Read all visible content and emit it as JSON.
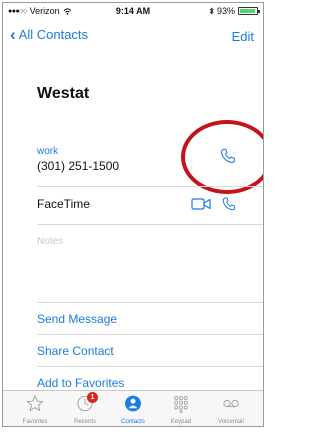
{
  "status_bar": {
    "carrier": "Verizon",
    "time": "9:14 AM",
    "battery_percent": "93%",
    "battery_level": 0.93
  },
  "nav": {
    "back_label": "All Contacts",
    "edit_label": "Edit"
  },
  "contact": {
    "name": "Westat",
    "phone_label": "work",
    "phone_number": "(301) 251-1500",
    "facetime_label": "FaceTime",
    "notes_placeholder": "Notes"
  },
  "actions": [
    "Send Message",
    "Share Contact",
    "Add to Favorites"
  ],
  "tabs": [
    {
      "label": "Favorites",
      "icon": "star-icon"
    },
    {
      "label": "Recents",
      "icon": "clock-icon",
      "badge": "1"
    },
    {
      "label": "Contacts",
      "icon": "person-icon",
      "active": true
    },
    {
      "label": "Keypad",
      "icon": "keypad-icon"
    },
    {
      "label": "Voicemail",
      "icon": "voicemail-icon"
    }
  ],
  "colors": {
    "accent": "#1a7ce8",
    "annotation_circle": "#c4141b",
    "badge": "#e0231b"
  }
}
